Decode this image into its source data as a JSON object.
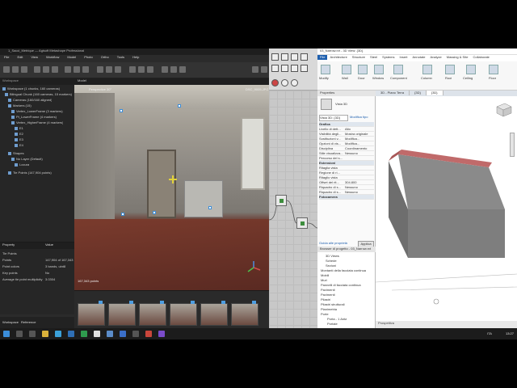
{
  "metashape": {
    "title": "1_Sacci_Metrique — Agisoft Metashape Professional",
    "menu": [
      "File",
      "Edit",
      "View",
      "Workflow",
      "Model",
      "Photo",
      "Ortho",
      "Tools",
      "Help"
    ],
    "workspace_header": "Workspace",
    "workspace_items": [
      {
        "label": "Workspace (1 chunks, 160 cameras)",
        "indent": 0
      },
      {
        "label": "Bilingual Chunk (160 cameras, 15 markers)",
        "indent": 1
      },
      {
        "label": "Cameras (160/160 aligned)",
        "indent": 2
      },
      {
        "label": "Markers (15)",
        "indent": 2
      },
      {
        "label": "Vertex_LowerFrame (3 markers)",
        "indent": 3
      },
      {
        "label": "Pt_LowerFrame (4 markers)",
        "indent": 3
      },
      {
        "label": "Vertex_HigherFrame (4 markers)",
        "indent": 3
      },
      {
        "label": "E1",
        "indent": 3
      },
      {
        "label": "E2",
        "indent": 3
      },
      {
        "label": "E3",
        "indent": 3
      },
      {
        "label": "E4",
        "indent": 3
      },
      {
        "label": "Shapes",
        "indent": 2
      },
      {
        "label": "No Layer (Default)",
        "indent": 3
      },
      {
        "label": "Locura",
        "indent": 3
      },
      {
        "label": "Tie Points (147,904 points)",
        "indent": 2
      }
    ],
    "properties_header": [
      "Property",
      "Value"
    ],
    "properties": [
      {
        "k": "Tie Points",
        "v": ""
      },
      {
        "k": "Points",
        "v": "147,904 of 167,343"
      },
      {
        "k": "Point colors",
        "v": "3 bands, uint8"
      },
      {
        "k": "Key points",
        "v": "No"
      },
      {
        "k": "Average tie point multiplicity",
        "v": "3.0304"
      }
    ],
    "bottom_tabs": [
      "Workspace",
      "Reference"
    ],
    "model_tab": "Model",
    "photo_label_left": "Perspective 30°",
    "photo_label_right": "DSC_9005.JPG",
    "photo_label_bottom": "167,343 points"
  },
  "revit": {
    "title": "03_Narrow.rvt - 3D View: {3D}",
    "tabs": [
      "File",
      "Architecture",
      "Structure",
      "Steel",
      "Systems",
      "Insert",
      "Annotate",
      "Analyze",
      "Massing & Site",
      "Collaborate",
      "View",
      "Manage"
    ],
    "ribbon_labels": [
      "Modify",
      "Wall",
      "Door",
      "Window",
      "Component",
      "Column",
      "Roof",
      "Ceiling",
      "Floor"
    ],
    "properties_header": "Properties",
    "view_type": "Vista 3D",
    "view_selector": "Vista 3D: {3D}",
    "edit_type": "Modifica tipo",
    "props": [
      {
        "k": "Grafica",
        "v": "",
        "head": true
      },
      {
        "k": "Livello di dett...",
        "v": "Alto"
      },
      {
        "k": "Visibilità degli...",
        "v": "Mostra originale"
      },
      {
        "k": "Sostituzioni v...",
        "v": "Modifica..."
      },
      {
        "k": "Opzioni di vis...",
        "v": "Modifica..."
      },
      {
        "k": "Disciplina",
        "v": "Coordinamento"
      },
      {
        "k": "Stile visualizza...",
        "v": "Nessuno"
      },
      {
        "k": "Percorso del s...",
        "v": ""
      },
      {
        "k": "Estensioni",
        "v": "",
        "head": true
      },
      {
        "k": "Ritaglia vista",
        "v": ""
      },
      {
        "k": "Regione di ri...",
        "v": ""
      },
      {
        "k": "Ritaglio vista",
        "v": ""
      },
      {
        "k": "Offset del rit...",
        "v": "304.800"
      },
      {
        "k": "Riquadro di s...",
        "v": "Nessuno"
      },
      {
        "k": "Riquadro di s...",
        "v": "Nessuno"
      },
      {
        "k": "Fotocamera",
        "v": "",
        "head": true
      }
    ],
    "properties_help": "Guida alle proprietà",
    "apply": "Applica",
    "browser_header": "Browser di progetto - 03_Narrow.rvt",
    "browser_items": [
      "3D Views",
      "Schede",
      "Sezioni",
      "Montanti della facciata continua",
      "Mobili",
      "Muri",
      "Pannelli di facciata continua",
      "Pavimenti",
      "Pavimenti",
      "Pilastri",
      "Pilastri strutturali",
      "Planimetria",
      "Porte",
      "Porta - 1 Anta",
      "Portale"
    ],
    "view_tabs": [
      "3D - Piano Terra",
      "{3D}",
      "{3D}"
    ],
    "status_text": "Prospettiva"
  },
  "taskbar": {
    "clock": "13:27",
    "lang": "ITA"
  },
  "colors": {
    "metashape_bg": "#2b2b2b",
    "revit_accent": "#1e5fae",
    "model_top": "#c06a6a",
    "model_body": "#8a8a8a"
  }
}
